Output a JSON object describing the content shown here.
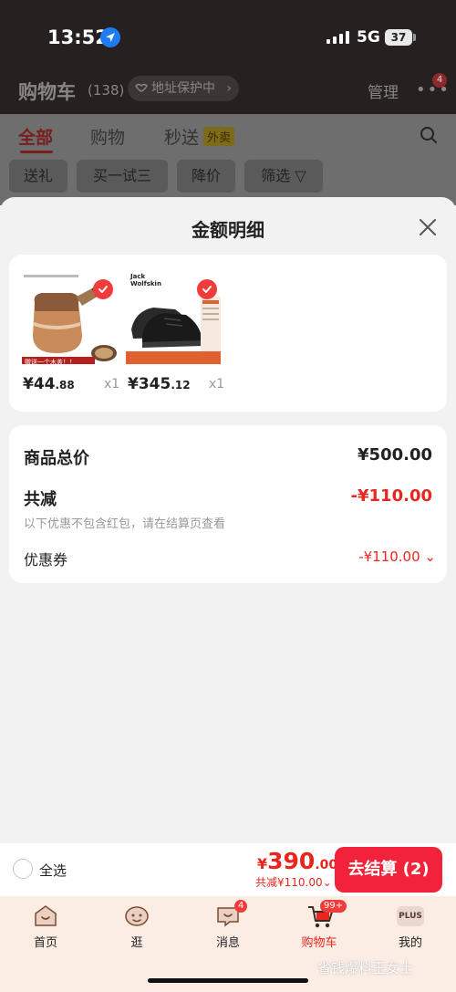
{
  "status_bar": {
    "time": "13:52",
    "network": "5G",
    "battery": "37"
  },
  "header": {
    "title": "购物车",
    "count": "(138)",
    "address_pill": "地址保护中",
    "manage": "管理",
    "more_badge": "4"
  },
  "tabs": [
    {
      "label": "全部"
    },
    {
      "label": "购物"
    },
    {
      "label": "秒送"
    }
  ],
  "flash_tag": "外卖",
  "chips": [
    {
      "label": "送礼"
    },
    {
      "label": "买一试三"
    },
    {
      "label": "降价"
    },
    {
      "label": "筛选"
    }
  ],
  "sheet": {
    "title": "金额明细",
    "products": [
      {
        "price_main": "¥44",
        "price_dec": ".88",
        "qty": "x1"
      },
      {
        "price_main": "¥345",
        "price_dec": ".12",
        "qty": "x1"
      }
    ],
    "product_1_banner": "赠送一个木盖！！",
    "product_2_brand_line1": "Jack",
    "product_2_brand_line2": "Wolfskin",
    "summary": {
      "total_label": "商品总价",
      "total_value": "¥500.00",
      "reduce_label": "共减",
      "reduce_value": "-¥110.00",
      "note": "以下优惠不包含红包，请在结算页查看",
      "coupon_label": "优惠券",
      "coupon_value": "-¥110.00"
    }
  },
  "checkout": {
    "select_all": "全选",
    "yen": "¥",
    "total_main": "390",
    "total_dec": ".00",
    "reduce_text": "共减¥110.00",
    "button_label": "去结算 (2)"
  },
  "bottom_nav": [
    {
      "label": "首页"
    },
    {
      "label": "逛"
    },
    {
      "label": "消息",
      "badge": "4"
    },
    {
      "label": "购物车",
      "badge": "99+"
    },
    {
      "label": "我的",
      "tag": "PLUS"
    }
  ],
  "watermark": "省钱爆料王女士",
  "colors": {
    "accent": "#f2223a",
    "price_red": "#e8261f",
    "check_red": "#f23b3b"
  }
}
